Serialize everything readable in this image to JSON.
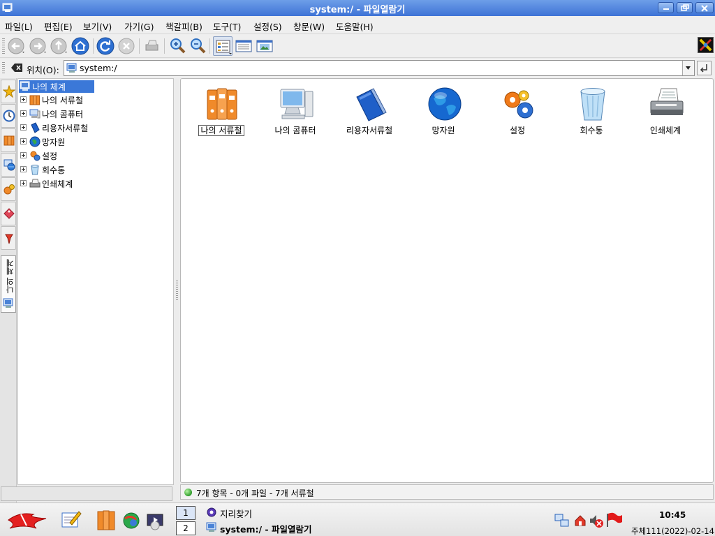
{
  "window": {
    "title": "system:/ - 파일열람기"
  },
  "menubar": {
    "items": [
      {
        "label": "파일(L)"
      },
      {
        "label": "편집(E)"
      },
      {
        "label": "보기(V)"
      },
      {
        "label": "가기(G)"
      },
      {
        "label": "책갈피(B)"
      },
      {
        "label": "도구(T)"
      },
      {
        "label": "설정(S)"
      },
      {
        "label": "창문(W)"
      },
      {
        "label": "도움말(H)"
      }
    ]
  },
  "toolbar": {
    "buttons": [
      "back-icon",
      "forward-icon",
      "up-icon",
      "home-icon",
      "reload-icon",
      "stop-icon",
      "print-icon",
      "zoom-in-icon",
      "zoom-out-icon",
      "icon-view-icon",
      "detail-view-icon",
      "preview-icon"
    ]
  },
  "location": {
    "label": "위치(O):",
    "value": "system:/"
  },
  "sidebar_tabs": {
    "vertical_label": "나의 체계"
  },
  "tree": {
    "root": "나의 체계",
    "items": [
      {
        "label": "나의 서류철"
      },
      {
        "label": "나의 콤퓨터"
      },
      {
        "label": "리용자서류철"
      },
      {
        "label": "망자원"
      },
      {
        "label": "설정"
      },
      {
        "label": "회수통"
      },
      {
        "label": "인쇄체계"
      }
    ]
  },
  "icons": [
    {
      "label": "나의 서류철",
      "icon": "folder-binders-icon",
      "selected": true
    },
    {
      "label": "나의 콤퓨터",
      "icon": "computer-icon"
    },
    {
      "label": "리용자서류철",
      "icon": "user-folders-icon"
    },
    {
      "label": "망자원",
      "icon": "network-globe-icon"
    },
    {
      "label": "설정",
      "icon": "settings-gears-icon"
    },
    {
      "label": "회수통",
      "icon": "trash-icon"
    },
    {
      "label": "인쇄체계",
      "icon": "printer-icon"
    }
  ],
  "status": {
    "text": "7개 항목 - 0개 파일 - 7개 서류철"
  },
  "taskbar": {
    "desktops": [
      "1",
      "2"
    ],
    "tasks": [
      {
        "label": "지리찾기"
      },
      {
        "label": "system:/ - 파일열람기"
      }
    ],
    "clock": "10:45",
    "date": "주체111(2022)-02-14"
  }
}
